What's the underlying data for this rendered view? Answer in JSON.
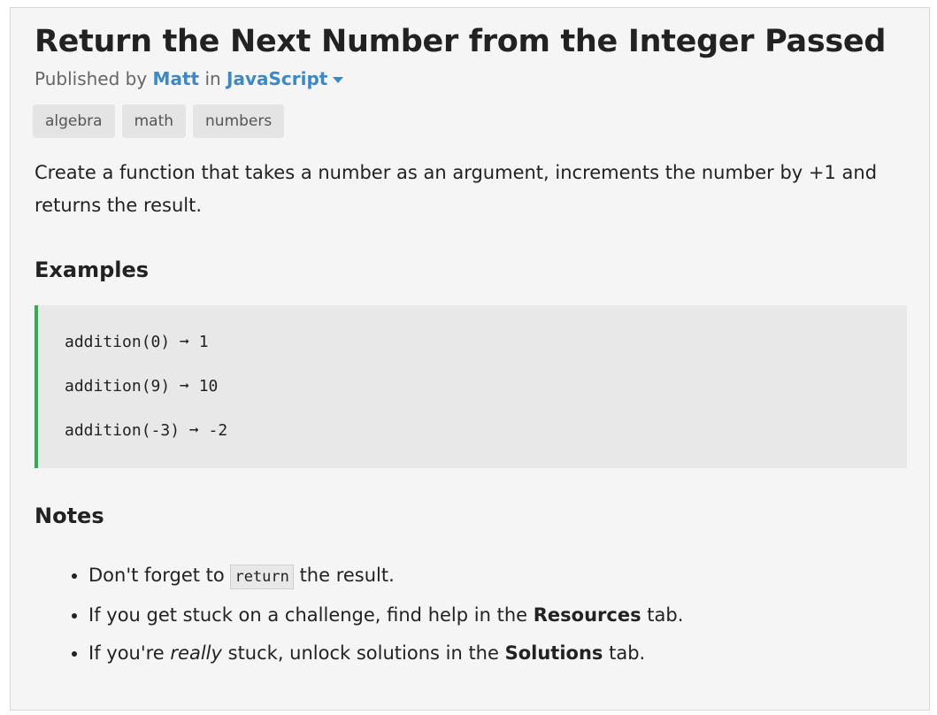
{
  "challenge": {
    "title": "Return the Next Number from the Integer Passed",
    "published_prefix": "Published by",
    "author": "Matt",
    "in_word": "in",
    "language": "JavaScript"
  },
  "tags": [
    "algebra",
    "math",
    "numbers"
  ],
  "description": "Create a function that takes a number as an argument, increments the number by +1 and returns the result.",
  "examples_heading": "Examples",
  "examples": [
    "addition(0) ➞ 1",
    "addition(9) ➞ 10",
    "addition(-3) ➞ -2"
  ],
  "notes_heading": "Notes",
  "notes": {
    "n1_a": "Don't forget to",
    "n1_code": "return",
    "n1_b": "the result.",
    "n2_a": "If you get stuck on a challenge, find help in the",
    "n2_bold": "Resources",
    "n2_b": "tab.",
    "n3_a": "If you're",
    "n3_em": "really",
    "n3_b": "stuck, unlock solutions in the",
    "n3_bold": "Solutions",
    "n3_c": "tab."
  },
  "colors": {
    "link": "#3b89c9",
    "code_border": "#30b04a"
  },
  "icons": {
    "language_dropdown": "caret-down-icon"
  }
}
